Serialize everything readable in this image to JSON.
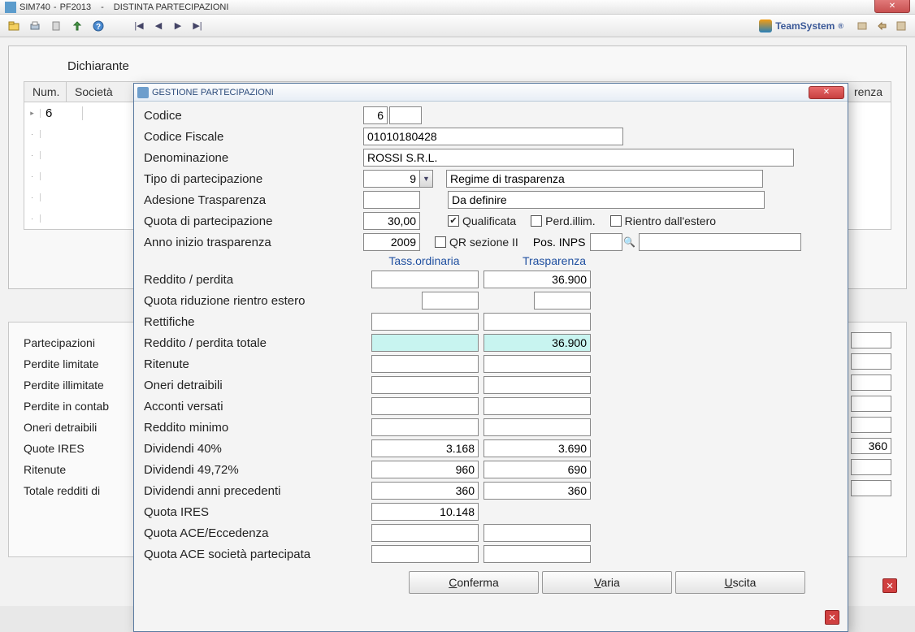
{
  "titlebar": {
    "app": "SIM740",
    "profile": "PF2013",
    "module": "DISTINTA PARTECIPAZIONI"
  },
  "brand": {
    "name": "TeamSystem",
    "mark": "®"
  },
  "bg": {
    "dichiarante": "Dichiarante",
    "headers": {
      "num": "Num.",
      "societa": "Società",
      "trasparenza": "renza"
    },
    "row_num": "6",
    "summary": [
      "Partecipazioni",
      "Perdite limitate",
      "Perdite illimitate",
      "Perdite in contab",
      "Oneri detraibili",
      "Quote IRES",
      "Ritenute",
      "Totale redditi di"
    ],
    "summary_val": "360"
  },
  "dialog": {
    "title": "GESTIONE PARTECIPAZIONI",
    "labels": {
      "codice": "Codice",
      "codice_fiscale": "Codice Fiscale",
      "denominazione": "Denominazione",
      "tipo_partecipazione": "Tipo di partecipazione",
      "adesione": "Adesione Trasparenza",
      "quota": "Quota di partecipazione",
      "anno": "Anno inizio trasparenza",
      "qualificata": "Qualificata",
      "perd_illim": "Perd.illim.",
      "rientro_estero": "Rientro dall'estero",
      "qr_sezione": "QR sezione II",
      "pos_inps": "Pos. INPS"
    },
    "values": {
      "codice": "6",
      "codice_ext": "",
      "codice_fiscale": "01010180428",
      "denominazione": "ROSSI S.R.L.",
      "tipo_partecipazione": "9",
      "tipo_partecipazione_desc": "Regime di trasparenza",
      "adesione": "",
      "adesione_desc": "Da definire",
      "quota": "30,00",
      "anno": "2009",
      "qualificata": true,
      "perd_illim": false,
      "rientro_estero": false,
      "qr_sezione": false,
      "pos_inps": "",
      "pos_inps_desc": ""
    },
    "col_headers": {
      "ordinaria": "Tass.ordinaria",
      "trasparenza": "Trasparenza"
    },
    "rows": [
      {
        "label": "Reddito / perdita",
        "ord": "",
        "trasp": "36.900"
      },
      {
        "label": "Quota riduzione rientro estero",
        "ord": "",
        "trasp": "",
        "short": true
      },
      {
        "label": "Rettifiche",
        "ord": "",
        "trasp": ""
      },
      {
        "label": "Reddito / perdita totale",
        "ord": "",
        "trasp": "36.900",
        "hl": true
      },
      {
        "label": "Ritenute",
        "ord": "",
        "trasp": ""
      },
      {
        "label": "Oneri detraibili",
        "ord": "",
        "trasp": ""
      },
      {
        "label": "Acconti versati",
        "ord": "",
        "trasp": ""
      },
      {
        "label": "Reddito minimo",
        "ord": "",
        "trasp": ""
      },
      {
        "label": "Dividendi 40%",
        "ord": "3.168",
        "trasp": "3.690"
      },
      {
        "label": "Dividendi 49,72%",
        "ord": "960",
        "trasp": "690"
      },
      {
        "label": "Dividendi anni precedenti",
        "ord": "360",
        "trasp": "360"
      },
      {
        "label": "Quota IRES",
        "ord": "10.148",
        "trasp": null
      },
      {
        "label": "Quota ACE/Eccedenza",
        "ord": "",
        "trasp": ""
      },
      {
        "label": "Quota ACE società partecipata",
        "ord": "",
        "trasp": ""
      }
    ],
    "buttons": {
      "conferma": "Conferma",
      "varia": "Varia",
      "uscita": "Uscita"
    }
  }
}
